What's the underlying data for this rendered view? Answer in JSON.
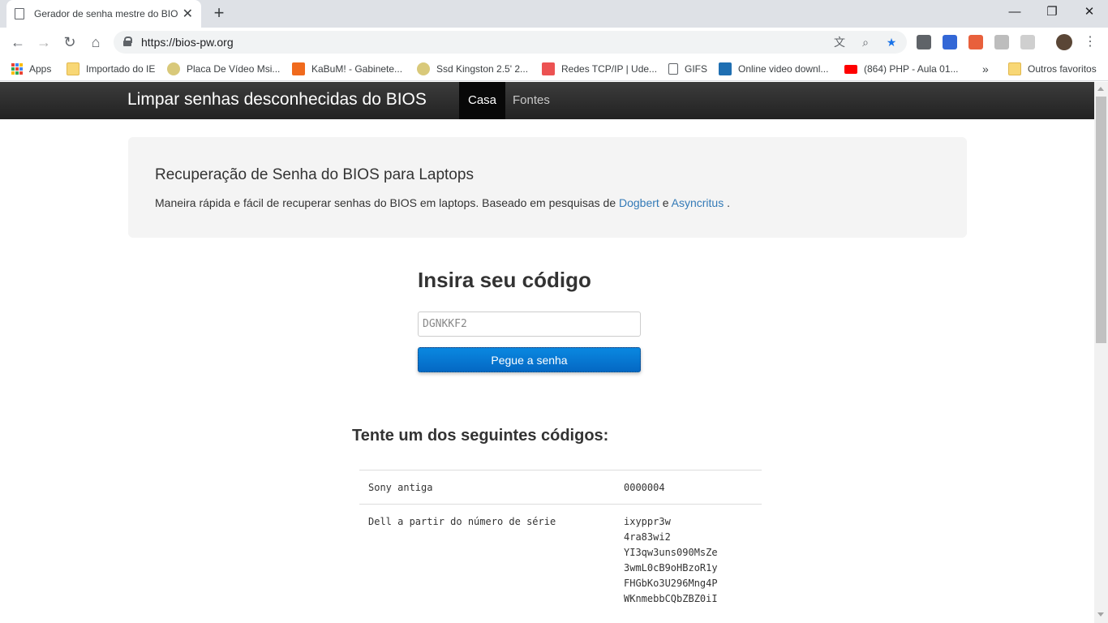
{
  "browser": {
    "tab_title": "Gerador de senha mestre do BIOS",
    "url": "https://bios-pw.org",
    "window_controls": [
      "—",
      "❐",
      "✕"
    ]
  },
  "bookmarks": [
    {
      "label": "Apps",
      "icon": "apps-icon"
    },
    {
      "label": "Importado do IE",
      "icon": "folder-icon"
    },
    {
      "label": "Placa De Vídeo Msi...",
      "icon": "disk-icon"
    },
    {
      "label": "KaBuM! - Gabinete...",
      "icon": "kabum-icon"
    },
    {
      "label": "Ssd Kingston 2.5' 2...",
      "icon": "disk-icon"
    },
    {
      "label": "Redes TCP/IP | Ude...",
      "icon": "udemy-icon"
    },
    {
      "label": "GIFS",
      "icon": "page-icon"
    },
    {
      "label": "Online video downl...",
      "icon": "cv-icon"
    },
    {
      "label": "(864) PHP - Aula 01...",
      "icon": "youtube-icon"
    },
    {
      "label": "Outros favoritos",
      "icon": "folder-icon"
    }
  ],
  "bookmarks_more": "»",
  "navbar": {
    "brand": "Limpar senhas desconhecidas do BIOS",
    "items": [
      {
        "label": "Casa",
        "active": true
      },
      {
        "label": "Fontes",
        "active": false
      }
    ]
  },
  "jumbotron": {
    "heading": "Recuperação de Senha do BIOS para Laptops",
    "text_before": "Maneira rápida e fácil de recuperar senhas do BIOS em laptops. Baseado em pesquisas de",
    "link1": "Dogbert",
    "conj": "e",
    "link2": "Asyncritus",
    "text_after": "."
  },
  "form": {
    "title": "Insira seu código",
    "input_value": "",
    "input_placeholder": "DGNKKF2",
    "button_label": "Pegue a senha"
  },
  "results": {
    "title": "Tente um dos seguintes códigos:",
    "rows": [
      {
        "name": "Sony antiga",
        "codes": [
          "0000004"
        ]
      },
      {
        "name": "Dell a partir do número de série",
        "codes": [
          "ixyppr3w",
          "4ra83wi2",
          "YI3qw3uns090MsZe",
          "3wmL0cB9oHBzoR1y",
          "FHGbKo3U296Mng4P",
          "WKnmebbCQbZBZ0iI"
        ]
      }
    ]
  },
  "colors": {
    "link": "#337ab7",
    "button": "#0a7fd6",
    "navbar": "#222222"
  }
}
